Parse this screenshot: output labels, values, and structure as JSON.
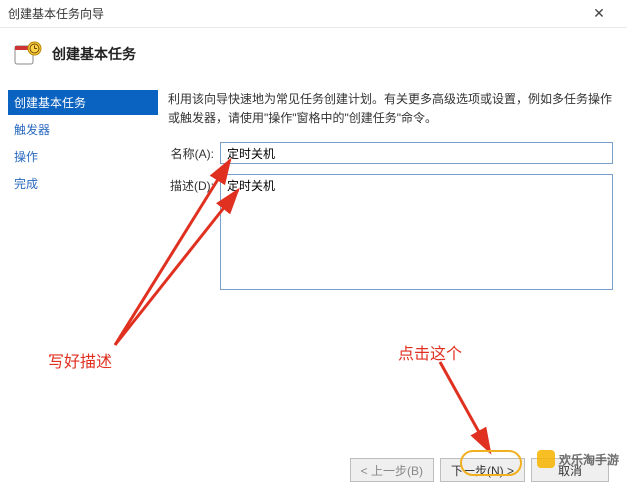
{
  "window": {
    "title": "创建基本任务向导"
  },
  "header": {
    "heading": "创建基本任务"
  },
  "sidebar": {
    "steps": [
      {
        "label": "创建基本任务",
        "active": true
      },
      {
        "label": "触发器",
        "active": false
      },
      {
        "label": "操作",
        "active": false
      },
      {
        "label": "完成",
        "active": false
      }
    ]
  },
  "main": {
    "intro": "利用该向导快速地为常见任务创建计划。有关更多高级选项或设置，例如多任务操作或触发器，请使用\"操作\"窗格中的\"创建任务\"命令。",
    "name_label": "名称(A):",
    "name_value": "定时关机",
    "desc_label": "描述(D):",
    "desc_value": "定时关机"
  },
  "footer": {
    "back": "< 上一步(B)",
    "next": "下一步(N) >",
    "cancel": "取消"
  },
  "annotations": {
    "left": "写好描述",
    "right": "点击这个"
  },
  "watermark": {
    "text": "欢乐淘手游"
  }
}
